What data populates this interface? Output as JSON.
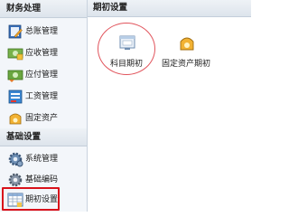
{
  "sidebar": {
    "groups": [
      {
        "title": "财务处理",
        "items": [
          {
            "label": "总账管理",
            "icon": "ledger-icon"
          },
          {
            "label": "应收管理",
            "icon": "receivable-icon"
          },
          {
            "label": "应付管理",
            "icon": "payable-icon"
          },
          {
            "label": "工资管理",
            "icon": "payroll-icon"
          },
          {
            "label": "固定资产",
            "icon": "fixed-asset-icon"
          }
        ]
      },
      {
        "title": "基础设置",
        "items": [
          {
            "label": "系统管理",
            "icon": "gear-icon"
          },
          {
            "label": "基础编码",
            "icon": "coding-icon"
          },
          {
            "label": "期初设置",
            "icon": "table-icon",
            "selected": true
          }
        ]
      }
    ]
  },
  "main": {
    "title": "期初设置",
    "tiles": [
      {
        "label": "科目期初",
        "icon": "account-opening-icon",
        "highlighted": true
      },
      {
        "label": "固定资产期初",
        "icon": "fixed-asset-opening-icon"
      }
    ]
  },
  "colors": {
    "highlight_red": "#d9121b",
    "circle_red": "#e1545c",
    "sidebar_bg": "#f3f6fa"
  }
}
